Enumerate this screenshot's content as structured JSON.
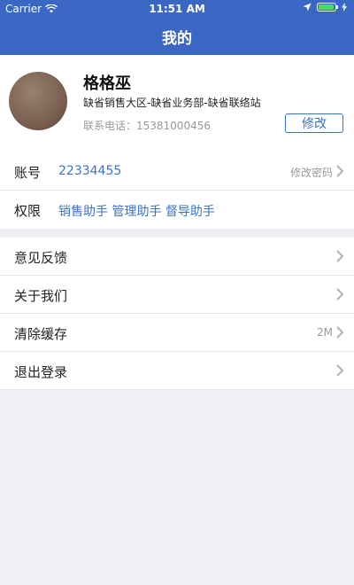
{
  "status_bar": {
    "carrier": "Carrier",
    "time": "11:51 AM"
  },
  "nav": {
    "title": "我的"
  },
  "profile": {
    "name": "格格巫",
    "department": "缺省销售大区-缺省业务部-缺省联络站",
    "phone": "联系电话：15381000456",
    "edit_label": "修改"
  },
  "info_rows": [
    {
      "label": "账号",
      "value": "22334455",
      "right": "修改密码"
    },
    {
      "label": "权限",
      "value": "销售助手 管理助手 督导助手"
    }
  ],
  "menu": [
    {
      "label": "意见反馈"
    },
    {
      "label": "关于我们"
    },
    {
      "label": "清除缓存",
      "right": "2M"
    },
    {
      "label": "退出登录"
    }
  ],
  "colors": {
    "nav_bg": "#3a66c4",
    "accent": "#3a73c4",
    "battery": "#4cd964",
    "page_bg": "#efeff4"
  }
}
